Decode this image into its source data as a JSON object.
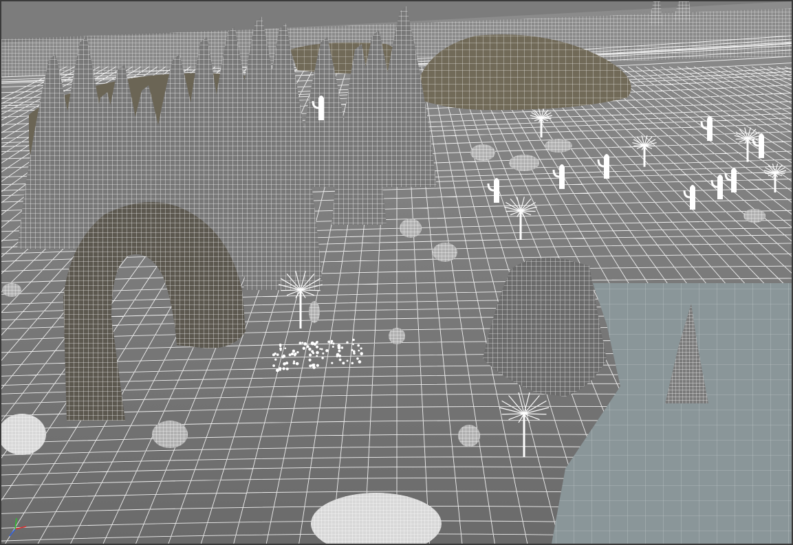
{
  "viewport": {
    "label": "",
    "shading": "wireframe-on-shaded",
    "colors": {
      "sky": "#7a7a7a",
      "ground_near": "#707070",
      "ground_far": "#858585",
      "wire": "#ffffff",
      "rock_fill": "#6e685a",
      "water": "#8b9799",
      "frame": "#3a3a3a"
    }
  },
  "gizmo": {
    "axes": [
      "x",
      "y",
      "z"
    ],
    "colors": {
      "x": "#e03030",
      "y": "#30c030",
      "z": "#3060e0"
    }
  },
  "scene_objects": [
    "ground-terrain-mesh",
    "rock-spire-cluster-mesh",
    "rock-arch-mesh",
    "mesa-rock-mesh",
    "background-butte-mesh",
    "small-spire-mesh",
    "joshua-tree-mesh",
    "cactus-mesh",
    "boulder-mesh",
    "scattered-pebbles-mesh",
    "water-plane-mesh"
  ]
}
